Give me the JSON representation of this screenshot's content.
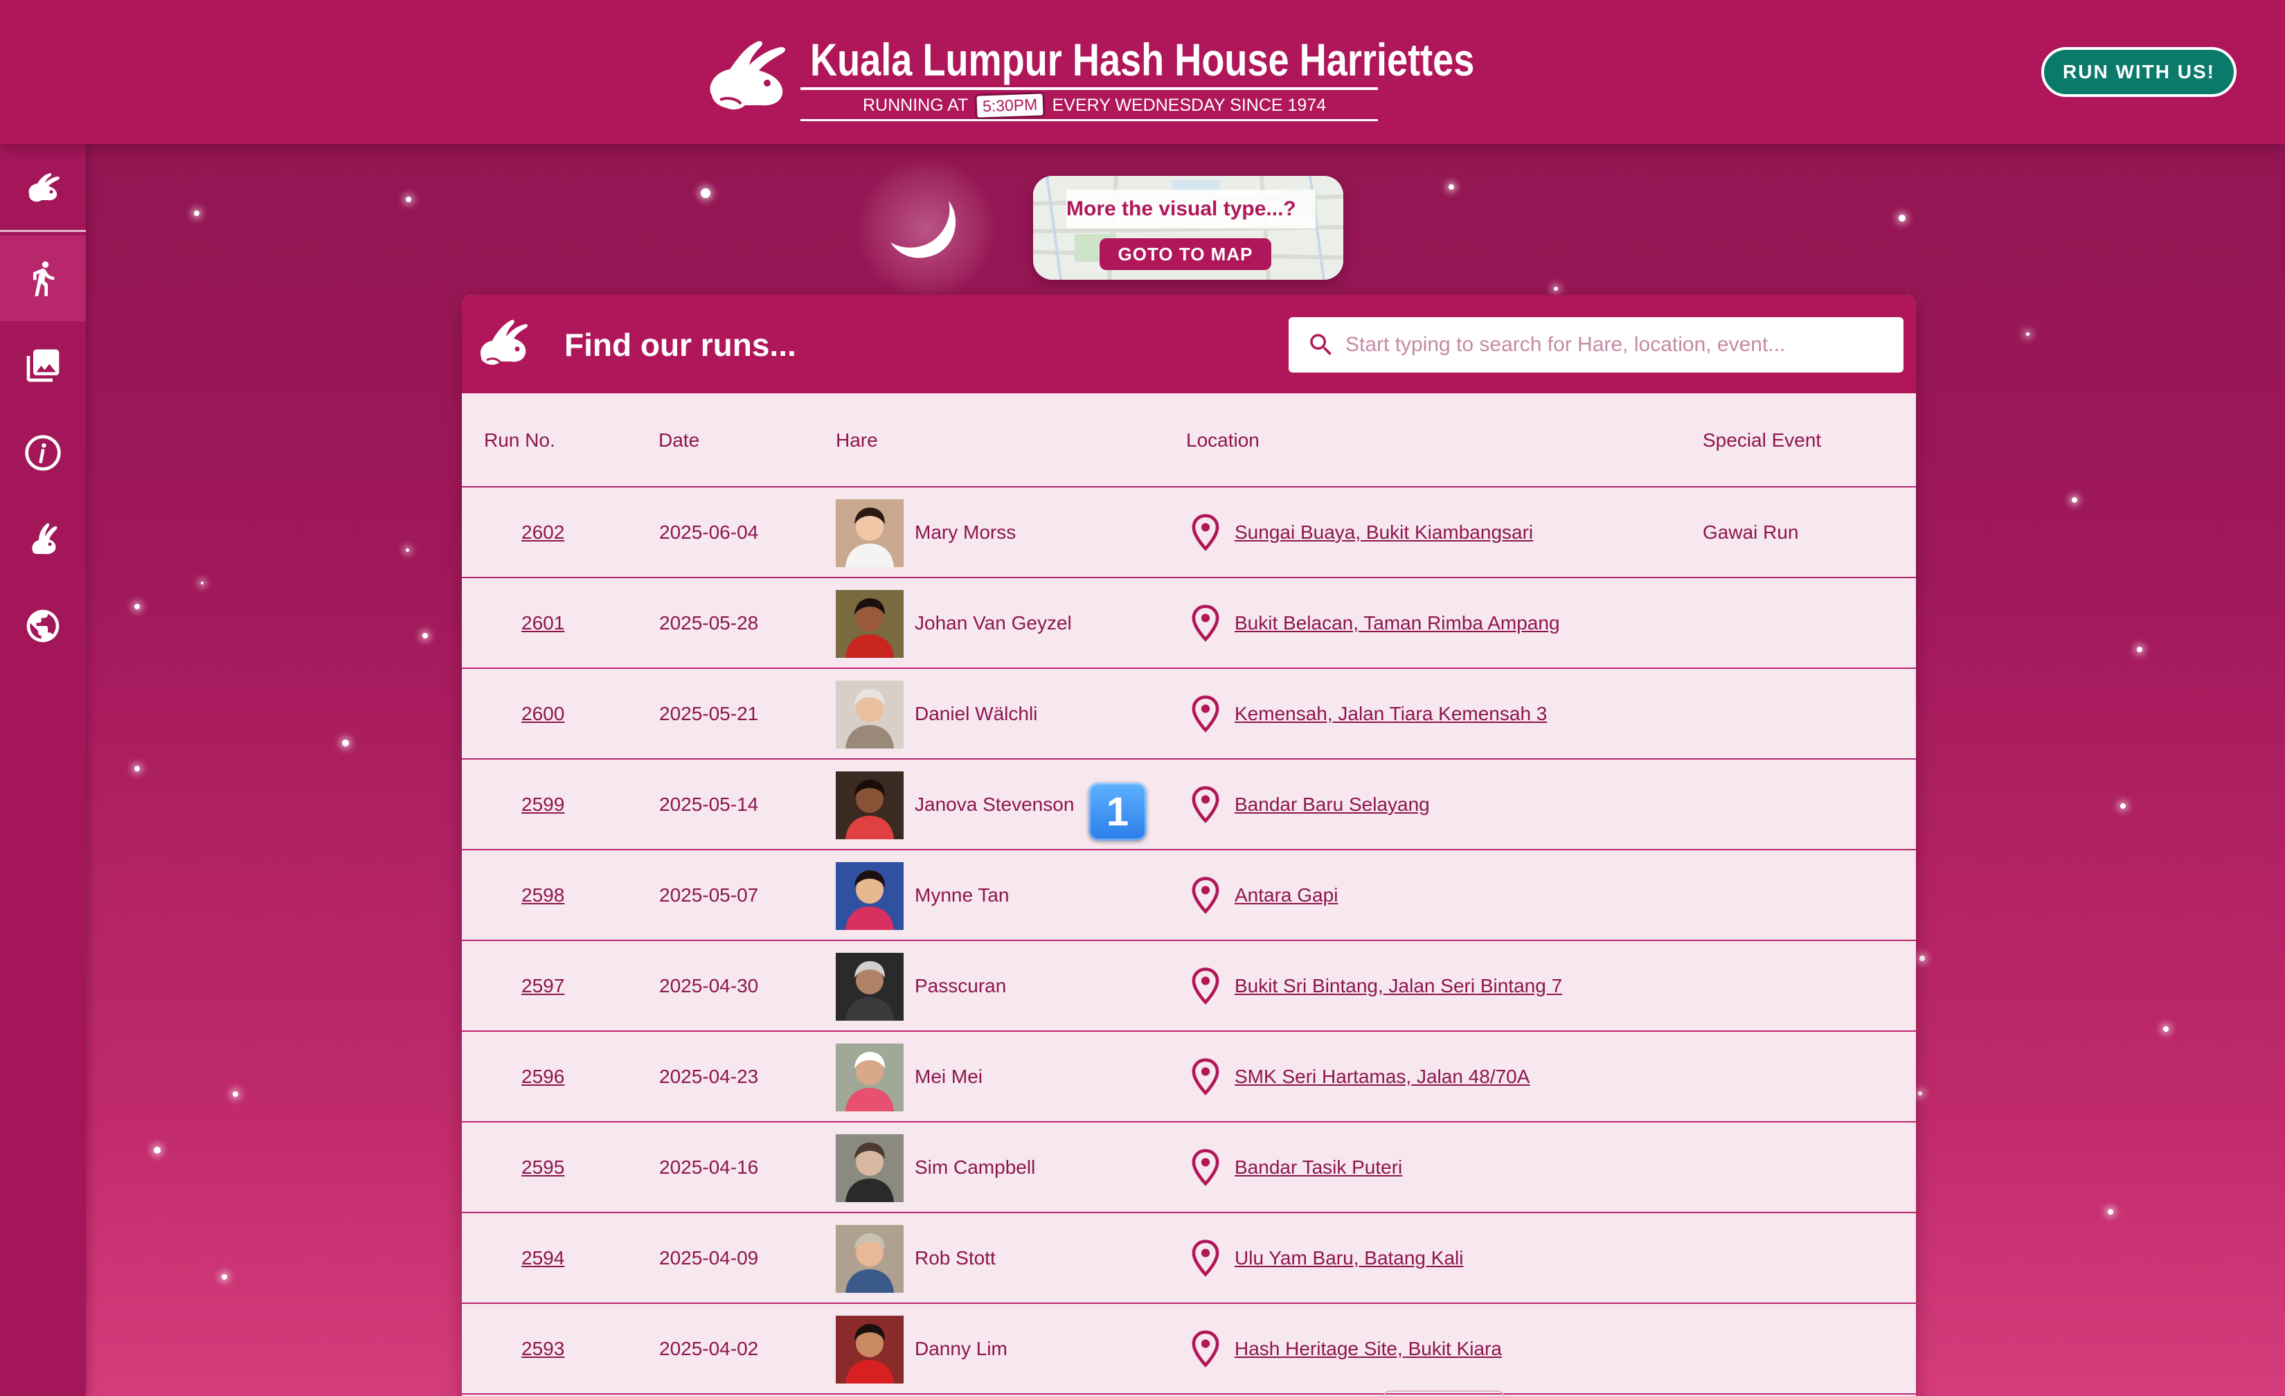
{
  "header": {
    "title": "Kuala Lumpur Hash House Harriettes",
    "tagline_before": "RUNNING AT",
    "tagline_time": "5:30PM",
    "tagline_after": "EVERY WEDNESDAY SINCE 1974",
    "cta_label": "RUN WITH US!"
  },
  "sidebar": {
    "items": [
      {
        "icon": "rabbit-logo-icon"
      },
      {
        "icon": "runner-icon",
        "active": true
      },
      {
        "icon": "gallery-icon"
      },
      {
        "icon": "info-icon"
      },
      {
        "icon": "hare-icon"
      },
      {
        "icon": "globe-icon"
      }
    ]
  },
  "map_card": {
    "question": "More the visual type...?",
    "button_label": "GOTO TO MAP"
  },
  "runs": {
    "title": "Find our runs...",
    "search_placeholder": "Start typing to search for Hare, location, event...",
    "columns": [
      "Run No.",
      "Date",
      "Hare",
      "Location",
      "Special Event"
    ],
    "rows": [
      {
        "run": "2602",
        "date": "2025-06-04",
        "hare": "Mary Morss",
        "location": "Sungai Buaya, Bukit Kiambangsari",
        "event": "Gawai Run"
      },
      {
        "run": "2601",
        "date": "2025-05-28",
        "hare": "Johan Van Geyzel",
        "location": "Bukit Belacan, Taman Rimba Ampang",
        "event": ""
      },
      {
        "run": "2600",
        "date": "2025-05-21",
        "hare": "Daniel Wälchli",
        "location": "Kemensah, Jalan Tiara Kemensah 3",
        "event": ""
      },
      {
        "run": "2599",
        "date": "2025-05-14",
        "hare": "Janova Stevenson",
        "location": "Bandar Baru Selayang",
        "event": ""
      },
      {
        "run": "2598",
        "date": "2025-05-07",
        "hare": "Mynne Tan",
        "location": "Antara Gapi",
        "event": ""
      },
      {
        "run": "2597",
        "date": "2025-04-30",
        "hare": "Passcuran",
        "location": "Bukit Sri Bintang, Jalan Seri Bintang 7",
        "event": ""
      },
      {
        "run": "2596",
        "date": "2025-04-23",
        "hare": "Mei Mei",
        "location": "SMK Seri Hartamas, Jalan 48/70A",
        "event": ""
      },
      {
        "run": "2595",
        "date": "2025-04-16",
        "hare": "Sim Campbell",
        "location": "Bandar Tasik Puteri",
        "event": ""
      },
      {
        "run": "2594",
        "date": "2025-04-09",
        "hare": "Rob Stott",
        "location": "Ulu Yam Baru, Batang Kali",
        "event": ""
      },
      {
        "run": "2593",
        "date": "2025-04-02",
        "hare": "Danny Lim",
        "location": "Hash Heritage Site, Bukit Kiara",
        "event": ""
      }
    ]
  },
  "overlay_badge": "1",
  "colors": {
    "brand": "#b0175a",
    "cta": "#0b7a6a",
    "panel": "#f6e8ee",
    "text": "#8e1550"
  }
}
